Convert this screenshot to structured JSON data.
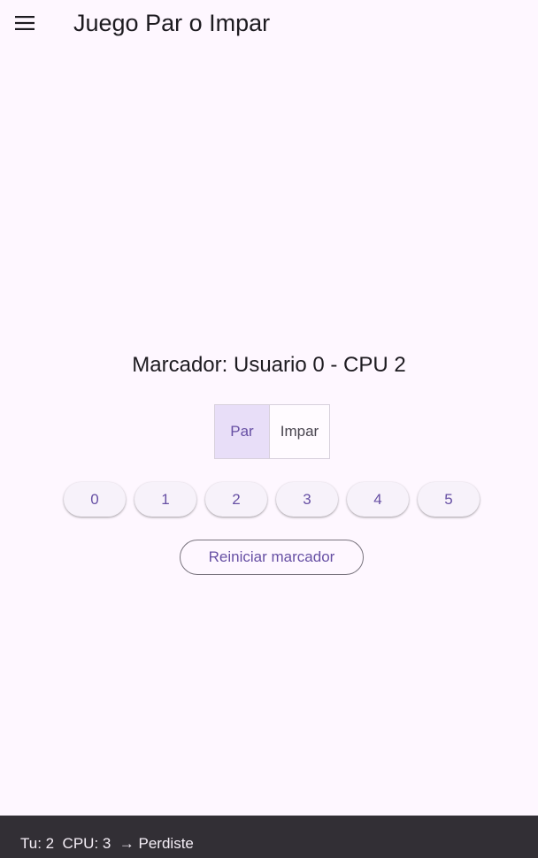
{
  "appbar": {
    "title": "Juego Par o Impar",
    "menu_icon": "menu-icon"
  },
  "score": {
    "text": "Marcador: Usuario 0 - CPU 2"
  },
  "choice": {
    "options": [
      "Par",
      "Impar"
    ],
    "selected": "Par"
  },
  "numbers": [
    "0",
    "1",
    "2",
    "3",
    "4",
    "5"
  ],
  "reset": {
    "label": "Reiniciar marcador"
  },
  "snackbar": {
    "text": "Tu: 2  CPU: 3  → Perdiste"
  },
  "colors": {
    "background": "#fef7ff",
    "primary": "#6750a4",
    "selected_segment": "#e8def8",
    "snackbar": "#322f35"
  }
}
